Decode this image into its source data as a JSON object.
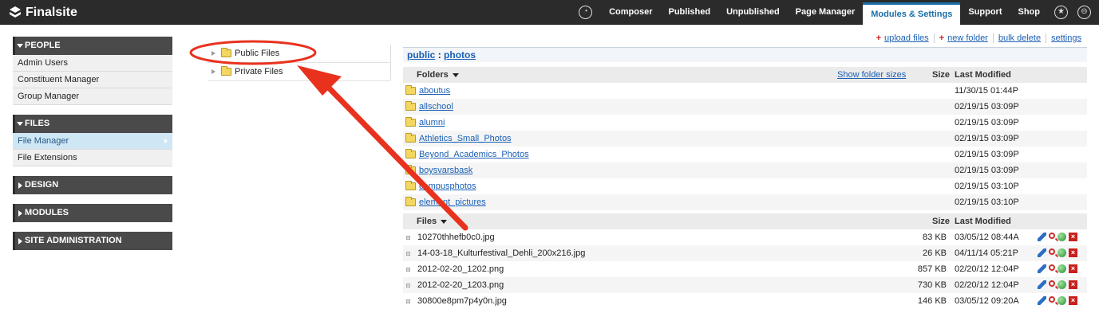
{
  "app": {
    "name": "Finalsite"
  },
  "nav": {
    "items": [
      {
        "label": "Composer"
      },
      {
        "label": "Published"
      },
      {
        "label": "Unpublished"
      },
      {
        "label": "Page Manager"
      },
      {
        "label": "Modules & Settings",
        "active": true
      },
      {
        "label": "Support"
      },
      {
        "label": "Shop"
      }
    ],
    "icons": [
      "dashboard-icon",
      "star-icon",
      "lock-icon"
    ]
  },
  "sidebar": {
    "people": {
      "label": "PEOPLE",
      "items": [
        "Admin Users",
        "Constituent Manager",
        "Group Manager"
      ]
    },
    "files": {
      "label": "FILES",
      "items": [
        "File Manager",
        "File Extensions"
      ],
      "selected": "File Manager"
    },
    "design": {
      "label": "DESIGN"
    },
    "modules": {
      "label": "MODULES"
    },
    "site_admin": {
      "label": "SITE ADMINISTRATION"
    }
  },
  "tree": {
    "items": [
      "Public Files",
      "Private Files"
    ]
  },
  "actions": {
    "upload": "upload files",
    "new_folder": "new folder",
    "bulk_delete": "bulk delete",
    "settings": "settings"
  },
  "path": {
    "root": "public",
    "separator": ":",
    "current": "photos"
  },
  "folders": {
    "header": "Folders",
    "show_sizes": "Show folder sizes",
    "size_col": "Size",
    "date_col": "Last Modified",
    "rows": [
      {
        "name": "aboutus",
        "date": "11/30/15 01:44P"
      },
      {
        "name": "allschool",
        "date": "02/19/15 03:09P"
      },
      {
        "name": "alumni",
        "date": "02/19/15 03:09P"
      },
      {
        "name": "Athletics_Small_Photos",
        "date": "02/19/15 03:09P"
      },
      {
        "name": "Beyond_Academics_Photos",
        "date": "02/19/15 03:09P"
      },
      {
        "name": "boysvarsbask",
        "date": "02/19/15 03:09P"
      },
      {
        "name": "campusphotos",
        "date": "02/19/15 03:10P"
      },
      {
        "name": "element_pictures",
        "date": "02/19/15 03:10P"
      }
    ]
  },
  "files": {
    "header": "Files",
    "size_col": "Size",
    "date_col": "Last Modified",
    "rows": [
      {
        "name": "10270thhefb0c0.jpg",
        "size": "83 KB",
        "date": "03/05/12 08:44A"
      },
      {
        "name": "14-03-18_Kulturfestival_Dehli_200x216.jpg",
        "size": "26 KB",
        "date": "04/11/14 05:21P"
      },
      {
        "name": "2012-02-20_1202.png",
        "size": "857 KB",
        "date": "02/20/12 12:04P"
      },
      {
        "name": "2012-02-20_1203.png",
        "size": "730 KB",
        "date": "02/20/12 12:04P"
      },
      {
        "name": "30800e8pm7p4y0n.jpg",
        "size": "146 KB",
        "date": "03/05/12 09:20A"
      }
    ]
  },
  "colors": {
    "annotation_red": "#e8321e",
    "link_blue": "#1a5fb4",
    "topbar": "#2b2b2b"
  }
}
